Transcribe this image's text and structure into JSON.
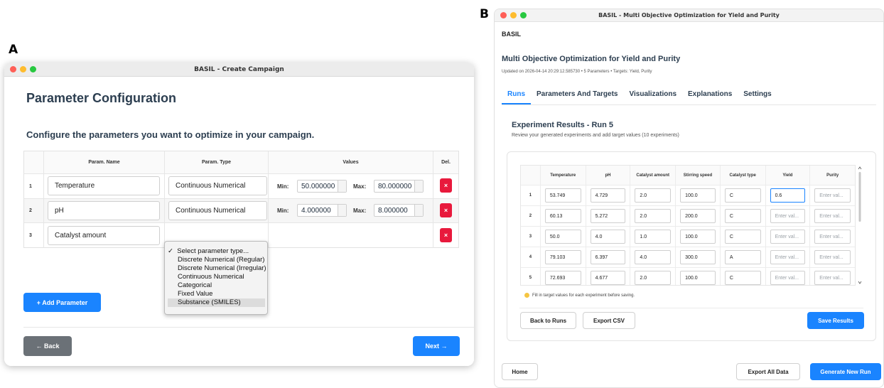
{
  "panels": {
    "a": "A",
    "b": "B"
  },
  "colors": {
    "accent": "#1a84ff",
    "danger": "#e8193c",
    "back_button": "#6b7177",
    "light_red": "#ff5f57",
    "light_yellow": "#febc2e",
    "light_green": "#28c840"
  },
  "window_a": {
    "title": "BASIL - Create Campaign",
    "heading": "Parameter Configuration",
    "subheading": "Configure the parameters you want to optimize in your campaign.",
    "table": {
      "headers": {
        "name": "Param. Name",
        "type": "Param. Type",
        "values": "Values",
        "del": "Del."
      },
      "rows": [
        {
          "index": "1",
          "name": "Temperature",
          "type": "Continuous Numerical",
          "min_label": "Min:",
          "min": "50.000000",
          "max_label": "Max:",
          "max": "80.000000",
          "del": "×"
        },
        {
          "index": "2",
          "name": "pH",
          "type": "Continuous Numerical",
          "min_label": "Min:",
          "min": "4.000000",
          "max_label": "Max:",
          "max": "8.000000",
          "del": "×"
        },
        {
          "index": "3",
          "name": "Catalyst amount",
          "del": "×"
        }
      ]
    },
    "type_dropdown": {
      "check": "✓",
      "options": [
        "Select parameter type...",
        "Discrete Numerical (Regular)",
        "Discrete Numerical (Irregular)",
        "Continuous Numerical",
        "Categorical",
        "Fixed Value",
        "Substance (SMILES)"
      ]
    },
    "add_parameter_label": "+ Add Parameter",
    "back_label": "← Back",
    "next_label": "Next →"
  },
  "window_b": {
    "title": "BASIL - Multi Objective Optimization for Yield and Purity",
    "brand": "BASIL",
    "campaign_title": "Multi Objective Optimization for Yield and Purity",
    "meta": "Updated on 2026-04-14 20:29:12.585730 • 5 Parameters • Targets: Yield, Purity",
    "tabs": [
      "Runs",
      "Parameters And Targets",
      "Visualizations",
      "Explanations",
      "Settings"
    ],
    "section_title": "Experiment Results - Run 5",
    "section_subtitle": "Review your generated experiments and add target values (10 experiments)",
    "table": {
      "headers": [
        "Temperature",
        "pH",
        "Catalyst amount",
        "Stirring speed",
        "Catalyst type",
        "Yield",
        "Purity"
      ],
      "placeholder": "Enter val...",
      "rows": [
        {
          "index": "1",
          "values": [
            "53.749",
            "4.729",
            "2.0",
            "100.0",
            "C"
          ],
          "yield": "0.6",
          "purity": ""
        },
        {
          "index": "2",
          "values": [
            "60.13",
            "5.272",
            "2.0",
            "200.0",
            "C"
          ],
          "yield": "",
          "purity": ""
        },
        {
          "index": "3",
          "values": [
            "50.0",
            "4.0",
            "1.0",
            "100.0",
            "C"
          ],
          "yield": "",
          "purity": ""
        },
        {
          "index": "4",
          "values": [
            "79.103",
            "6.397",
            "4.0",
            "300.0",
            "A"
          ],
          "yield": "",
          "purity": ""
        },
        {
          "index": "5",
          "values": [
            "72.693",
            "4.677",
            "2.0",
            "100.0",
            "C"
          ],
          "yield": "",
          "purity": ""
        }
      ]
    },
    "tip": "Fill in target values for each experiment before saving.",
    "back_to_runs_label": "Back to Runs",
    "export_csv_label": "Export CSV",
    "save_results_label": "Save Results",
    "home_label": "Home",
    "export_all_label": "Export All Data",
    "generate_label": "Generate New Run"
  }
}
